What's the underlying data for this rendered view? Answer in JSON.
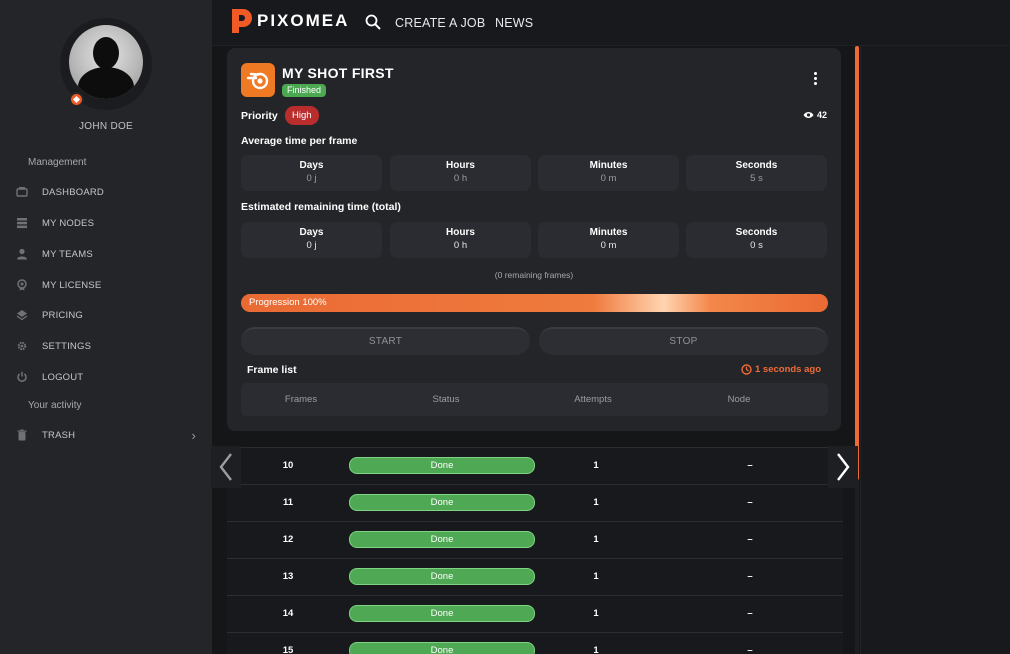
{
  "sidebar": {
    "user_name": "JOHN DOE",
    "section_management": "Management",
    "items": [
      {
        "label": "DASHBOARD",
        "icon": "dashboard-icon"
      },
      {
        "label": "MY NODES",
        "icon": "nodes-icon"
      },
      {
        "label": "MY TEAMS",
        "icon": "teams-icon"
      },
      {
        "label": "MY LICENSE",
        "icon": "license-icon"
      },
      {
        "label": "PRICING",
        "icon": "pricing-icon"
      },
      {
        "label": "SETTINGS",
        "icon": "gear-icon"
      },
      {
        "label": "LOGOUT",
        "icon": "power-icon"
      }
    ],
    "section_activity": "Your activity",
    "trash_label": "TRASH"
  },
  "topbar": {
    "logo_text": "PIXOMEA",
    "create_job": "CREATE A JOB",
    "news": "NEWS"
  },
  "job": {
    "title": "MY SHOT FIRST",
    "status": "Finished",
    "priority_label": "Priority",
    "priority_value": "High",
    "views": "42",
    "avg_title": "Average time per frame",
    "avg": [
      {
        "label": "Days",
        "value": "0 j"
      },
      {
        "label": "Hours",
        "value": "0 h"
      },
      {
        "label": "Minutes",
        "value": "0 m"
      },
      {
        "label": "Seconds",
        "value": "5 s"
      }
    ],
    "est_title": "Estimated remaining time (total)",
    "est": [
      {
        "label": "Days",
        "value": "0 j"
      },
      {
        "label": "Hours",
        "value": "0 h"
      },
      {
        "label": "Minutes",
        "value": "0 m"
      },
      {
        "label": "Seconds",
        "value": "0 s"
      }
    ],
    "remaining_frames": "(0 remaining frames)",
    "progress_label": "Progression 100%",
    "progress": 1.0,
    "start_label": "START",
    "stop_label": "STOP",
    "frame_list_title": "Frame list",
    "updated": "1 seconds ago",
    "columns": [
      "Frames",
      "Status",
      "Attempts",
      "Node"
    ]
  },
  "frames": [
    {
      "frame": "10",
      "status": "Done",
      "attempts": "1",
      "node": "–"
    },
    {
      "frame": "11",
      "status": "Done",
      "attempts": "1",
      "node": "–"
    },
    {
      "frame": "12",
      "status": "Done",
      "attempts": "1",
      "node": "–"
    },
    {
      "frame": "13",
      "status": "Done",
      "attempts": "1",
      "node": "–"
    },
    {
      "frame": "14",
      "status": "Done",
      "attempts": "1",
      "node": "–"
    },
    {
      "frame": "15",
      "status": "Done",
      "attempts": "1",
      "node": "–"
    }
  ],
  "colors": {
    "accent": "#ef6b36",
    "done": "#4fa854",
    "high": "#b92d2d",
    "sidebar": "#242529",
    "background": "#151618"
  }
}
